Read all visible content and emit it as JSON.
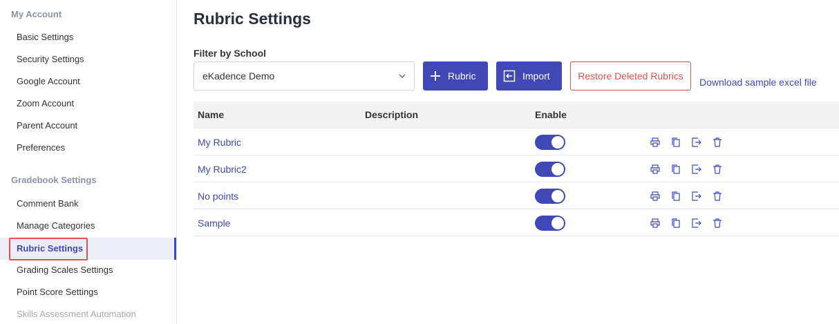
{
  "sidebar": {
    "sections": [
      {
        "title": "My Account",
        "items": [
          "Basic Settings",
          "Security Settings",
          "Google Account",
          "Zoom Account",
          "Parent Account",
          "Preferences"
        ]
      },
      {
        "title": "Gradebook Settings",
        "items": [
          "Comment Bank",
          "Manage Categories",
          "Rubric Settings",
          "Grading Scales Settings",
          "Point Score Settings",
          "Skills Assessment Automation"
        ]
      }
    ],
    "active_item": "Rubric Settings"
  },
  "main": {
    "title": "Rubric Settings",
    "filter_label": "Filter by School",
    "school_selected": "eKadence Demo",
    "buttons": {
      "rubric": "Rubric",
      "import": "Import",
      "restore": "Restore Deleted Rubrics"
    },
    "download_link": "Download sample excel file",
    "table": {
      "headers": {
        "name": "Name",
        "description": "Description",
        "enable": "Enable"
      },
      "rows": [
        {
          "name": "My Rubric",
          "description": "",
          "enabled": true
        },
        {
          "name": "My Rubric2",
          "description": "",
          "enabled": true
        },
        {
          "name": "No points",
          "description": "",
          "enabled": true
        },
        {
          "name": "Sample",
          "description": "",
          "enabled": true
        }
      ]
    }
  },
  "colors": {
    "accent": "#3f48b4",
    "danger": "#d9534f",
    "highlight": "#e0524f"
  },
  "icons": {
    "row_actions": [
      "print-icon",
      "copy-icon",
      "export-icon",
      "trash-icon"
    ],
    "rubric_button": "plus-icon",
    "import_button": "import-icon",
    "select": "chevron-down-icon"
  }
}
